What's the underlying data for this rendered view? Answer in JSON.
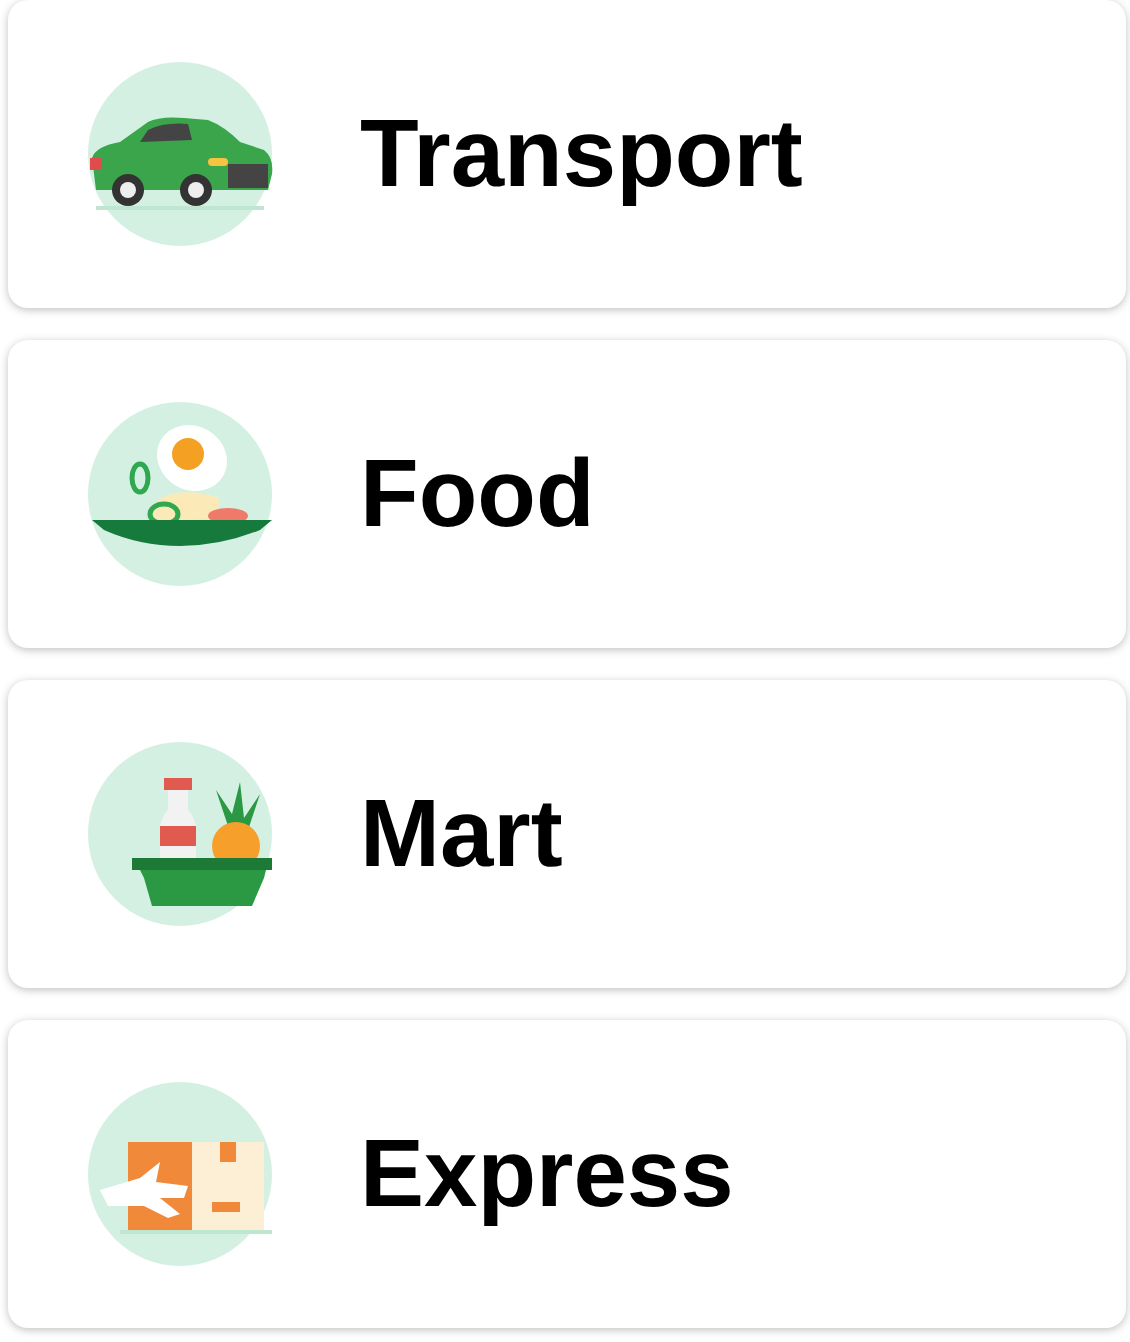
{
  "services": [
    {
      "label": "Transport",
      "kind": "car"
    },
    {
      "label": "Food",
      "kind": "meal"
    },
    {
      "label": "Mart",
      "kind": "basket"
    },
    {
      "label": "Express",
      "kind": "parcel"
    }
  ]
}
